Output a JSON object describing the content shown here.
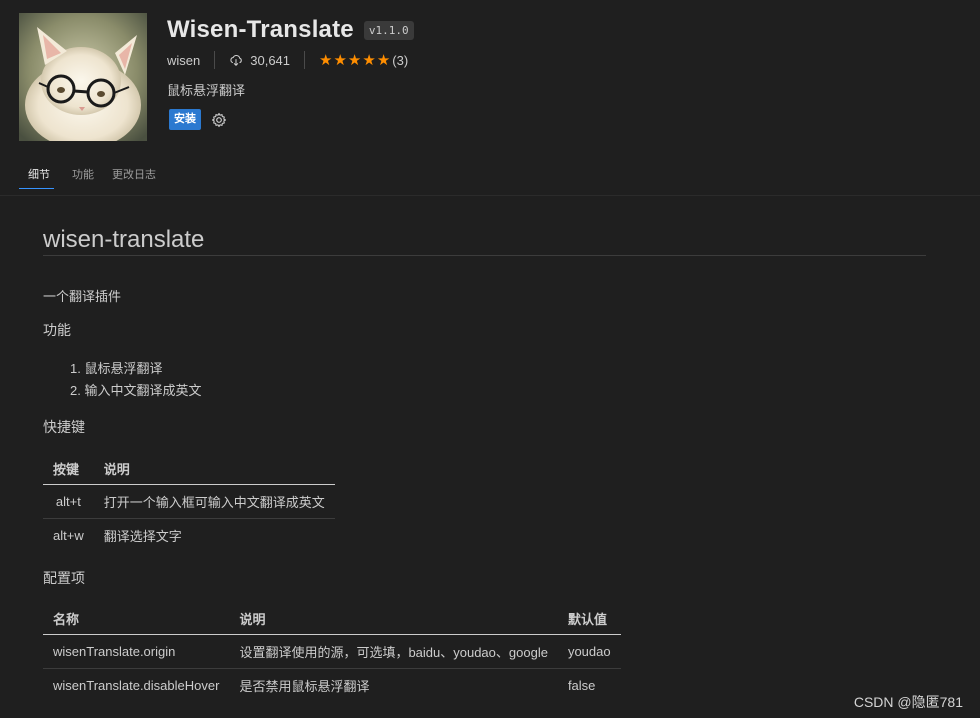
{
  "extension": {
    "name": "Wisen-Translate",
    "version": "v1.1.0",
    "publisher": "wisen",
    "downloads": "30,641",
    "rating_stars": 5,
    "rating_count": "(3)",
    "description": "鼠标悬浮翻译",
    "install_label": "安装"
  },
  "tabs": [
    {
      "label": "细节",
      "active": true
    },
    {
      "label": "功能",
      "active": false
    },
    {
      "label": "更改日志",
      "active": false
    }
  ],
  "readme": {
    "title": "wisen-translate",
    "intro": "一个翻译插件",
    "features_heading": "功能",
    "features": [
      "鼠标悬浮翻译",
      "输入中文翻译成英文"
    ],
    "shortcuts_heading": "快捷键",
    "shortcuts_table": {
      "headers": [
        "按键",
        "说明"
      ],
      "rows": [
        [
          "alt+t",
          "打开一个输入框可输入中文翻译成英文"
        ],
        [
          "alt+w",
          "翻译选择文字"
        ]
      ]
    },
    "config_heading": "配置项",
    "config_table": {
      "headers": [
        "名称",
        "说明",
        "默认值"
      ],
      "rows": [
        [
          "wisenTranslate.origin",
          "设置翻译使用的源，可选填，baidu、youdao、google",
          "youdao"
        ],
        [
          "wisenTranslate.disableHover",
          "是否禁用鼠标悬浮翻译",
          "false"
        ]
      ]
    }
  },
  "watermark": "CSDN @隐匿781",
  "colors": {
    "background": "#1f1f1f",
    "accent": "#3794ff",
    "star": "#ff8e00",
    "install_button": "#2b79d0"
  }
}
